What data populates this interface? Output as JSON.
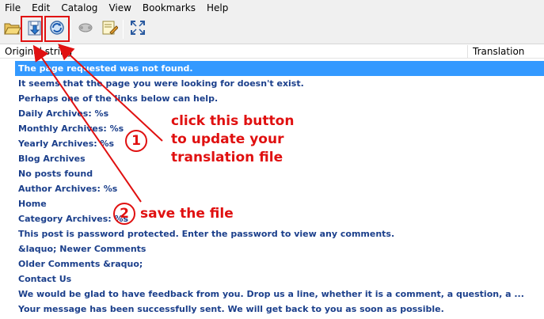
{
  "menu": [
    "File",
    "Edit",
    "Catalog",
    "View",
    "Bookmarks",
    "Help"
  ],
  "toolbar": {
    "buttons": [
      {
        "name": "open-catalog-icon"
      },
      {
        "name": "save-catalog-icon"
      },
      {
        "name": "update-catalog-icon"
      },
      {
        "name": "validate-translations-icon"
      },
      {
        "name": "edit-comment-icon"
      },
      {
        "name": "fullscreen-icon"
      }
    ]
  },
  "columns": {
    "original": "Original string",
    "translation": "Translation"
  },
  "rows": [
    "The page requested was not found.",
    "It seems that the page you were looking for doesn't exist.",
    "Perhaps one of the links below can help.",
    "Daily Archives: %s",
    "Monthly Archives: %s",
    "Yearly Archives: %s",
    "Blog Archives",
    "No posts found",
    "Author Archives: %s",
    "Home",
    "Category Archives: %s",
    "This post is password protected. Enter the password to view any comments.",
    "&laquo; Newer Comments",
    "Older Comments &raquo;",
    "Contact Us",
    "We would be glad to have feedback from you. Drop us a line, whether it is a comment, a question, a ...",
    "Your message has been successfully sent. We will get back to you as soon as possible."
  ],
  "selected_row": 0,
  "annotations": {
    "step1_number": "1",
    "step1_line1": "click this button",
    "step1_line2": "to update your",
    "step1_line3": "translation file",
    "step2_number": "2",
    "step2_text": "save the file",
    "color": "#e01010"
  },
  "colors": {
    "selection": "#3399ff",
    "row_text": "#1b3f8b"
  }
}
